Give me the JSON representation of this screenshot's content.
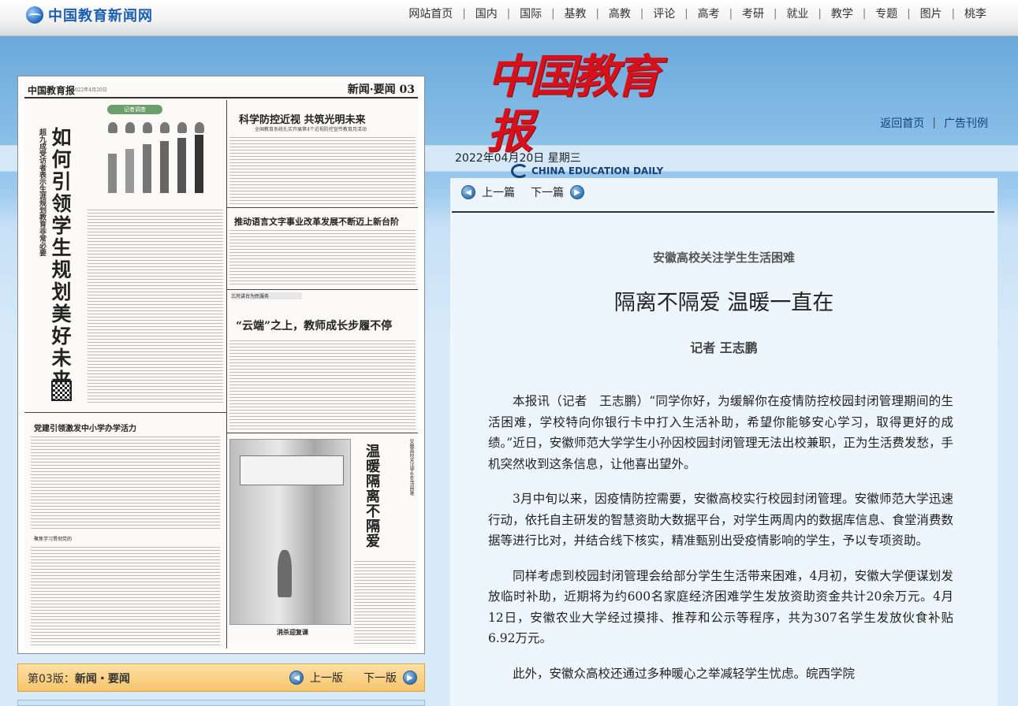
{
  "site": {
    "logo_text": "中国教育新闻网",
    "nav": [
      "网站首页",
      "国内",
      "国际",
      "基教",
      "高教",
      "评论",
      "高考",
      "考研",
      "就业",
      "教学",
      "专题",
      "图片",
      "桃李"
    ]
  },
  "masthead": {
    "title_cn": "中国教育报",
    "title_en": "CHINA EDUCATION DAILY",
    "links": [
      "返回首页",
      "广告刊例"
    ]
  },
  "date": "2022年04月20日  星期三",
  "paper": {
    "name": "中国教育报",
    "date": "2022年4月20日",
    "section": "新闻·要闻 03",
    "lead_title": "如何引领学生规划美好未来",
    "lead_sub": "超九成受访者表示生涯规划教育非常必要",
    "badge": "记者调查",
    "top_right_title": "科学防控近视 共筑光明未来",
    "top_right_sub": "全国教育系统扎实开展第4个近视防控宣传教育月活动",
    "mid_right_title": "推动语言文字事业改革发展不断迈上新台阶",
    "tag": "三尺讲台为民服务",
    "feature_title": "“云端”之上，教师成长步履不停",
    "left_title2": "党建引领激发中小学办学活力",
    "left_tag3": "聚焦学习贯彻党的",
    "vertical_title2": "温暖隔离不隔爱",
    "vertical_sub2": "安徽高校关注学生生活困难",
    "photo_caption": "消杀迎复课"
  },
  "version_bar": {
    "label_prefix": "第03版：",
    "label_name": "新闻・要闻",
    "prev": "上一版",
    "next": "下一版"
  },
  "article": {
    "prev": "上一篇",
    "next": "下一篇",
    "kicker": "安徽高校关注学生生活困难",
    "headline": "隔离不隔爱 温暖一直在",
    "byline": "记者  王志鹏",
    "paragraphs": [
      "本报讯（记者　王志鹏）“同学你好，为缓解你在疫情防控校园封闭管理期间的生活困难，学校特向你银行卡中打入生活补助，希望你能够安心学习，取得更好的成绩。”近日，安徽师范大学学生小孙因校园封闭管理无法出校兼职，正为生活费发愁，手机突然收到这条信息，让他喜出望外。",
      "3月中旬以来，因疫情防控需要，安徽高校实行校园封闭管理。安徽师范大学迅速行动，依托自主研发的智慧资助大数据平台，对学生两周内的数据库信息、食堂消费数据等进行比对，并结合线下核实，精准甄别出受疫情影响的学生，予以专项资助。",
      "同样考虑到校园封闭管理会给部分学生生活带来困难，4月初，安徽大学便谋划发放临时补助，近期将为约600名家庭经济困难学生发放资助资金共计20余万元。4月12日，安徽农业大学经过摸排、推荐和公示等程序，共为307名学生发放伙食补贴6.92万元。",
      "此外，安徽众高校还通过多种暖心之举减轻学生忧虑。皖西学院"
    ]
  }
}
